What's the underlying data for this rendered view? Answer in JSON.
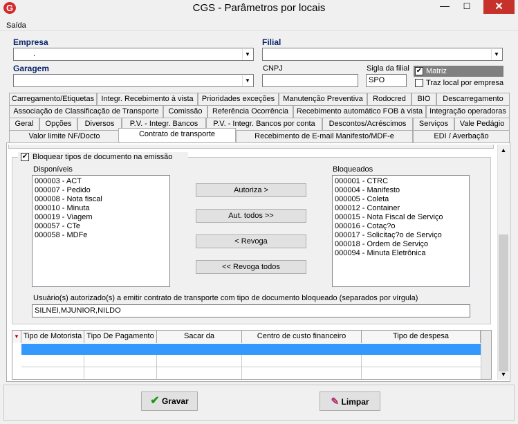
{
  "window": {
    "title": "CGS - Parâmetros por locais",
    "logo": "G",
    "close": "✕",
    "minimize": "—",
    "maximize": "☐"
  },
  "menu": {
    "saida": "Saída"
  },
  "header": {
    "empresa_label": "Empresa",
    "empresa_value": ".",
    "filial_label": "Filial",
    "filial_value": "",
    "garagem_label": "Garagem",
    "garagem_value": "",
    "cnpj_label": "CNPJ",
    "cnpj_value": "",
    "sigla_label": "Sigla da filial",
    "sigla_value": "SPO",
    "matriz_label": "Matriz",
    "matriz_checked": true,
    "traz_local_label": "Traz local por empresa",
    "traz_local_checked": false
  },
  "tabs": {
    "row1": [
      "Carregamento/Etiquetas",
      "Integr. Recebimento à vista",
      "Prioridades exceções",
      "Manutenção Preventiva",
      "Rodocred",
      "BIO",
      "Descarregamento"
    ],
    "row2": [
      "Associação de Classificação de Transporte",
      "Comissão",
      "Referência Ocorrência",
      "Recebimento automático FOB à vista",
      "Integração operadoras"
    ],
    "row3": [
      "Geral",
      "Opções",
      "Diversos",
      "P.V. - Integr. Bancos",
      "P.V. - Integr. Bancos por conta",
      "Descontos/Acréscimos",
      "Serviços",
      "Vale Pedágio"
    ],
    "row4": [
      "Valor limite NF/Docto",
      "Contrato de transporte",
      "Recebimento de E-mail Manifesto/MDF-e",
      "EDI / Averbação"
    ]
  },
  "content": {
    "bloquear_label": "Bloquear tipos de documento na emissão",
    "bloquear_checked": true,
    "disponiveis_label": "Disponíveis",
    "disponiveis": [
      "000003 - ACT",
      "000007 - Pedido",
      "000008 - Nota fiscal",
      "000010 - Minuta",
      "000019 - Viagem",
      "000057 - CTe",
      "000058 - MDFe"
    ],
    "bloqueados_label": "Bloqueados",
    "bloqueados": [
      "000001 - CTRC",
      "000004 - Manifesto",
      "000005 - Coleta",
      "000012 - Container",
      "000015 - Nota Fiscal de Serviço",
      "000016 - Cotaç?o",
      "000017 - Solicitaç?o de Serviço",
      "000018 - Ordem de Serviço",
      "000094 - Minuta Eletrônica"
    ],
    "autoriza": "Autoriza >",
    "aut_todos": "Aut. todos >>",
    "revoga": "< Revoga",
    "revoga_todos": "<< Revoga todos",
    "usuarios_label": "Usuário(s) autorizado(s) a emitir contrato de transporte com tipo de documento bloqueado (separados por vírgula)",
    "usuarios_value": "SILNEI,MJUNIOR,NILDO"
  },
  "grid": {
    "columns": [
      "Tipo de Motorista",
      "Tipo De Pagamento",
      "Sacar da",
      "Centro de custo financeiro",
      "Tipo de despesa"
    ]
  },
  "footer": {
    "gravar": "Gravar",
    "limpar": "Limpar"
  },
  "colors": {
    "accent": "#0a246a",
    "selection": "#3399ff",
    "close": "#c7312b"
  }
}
